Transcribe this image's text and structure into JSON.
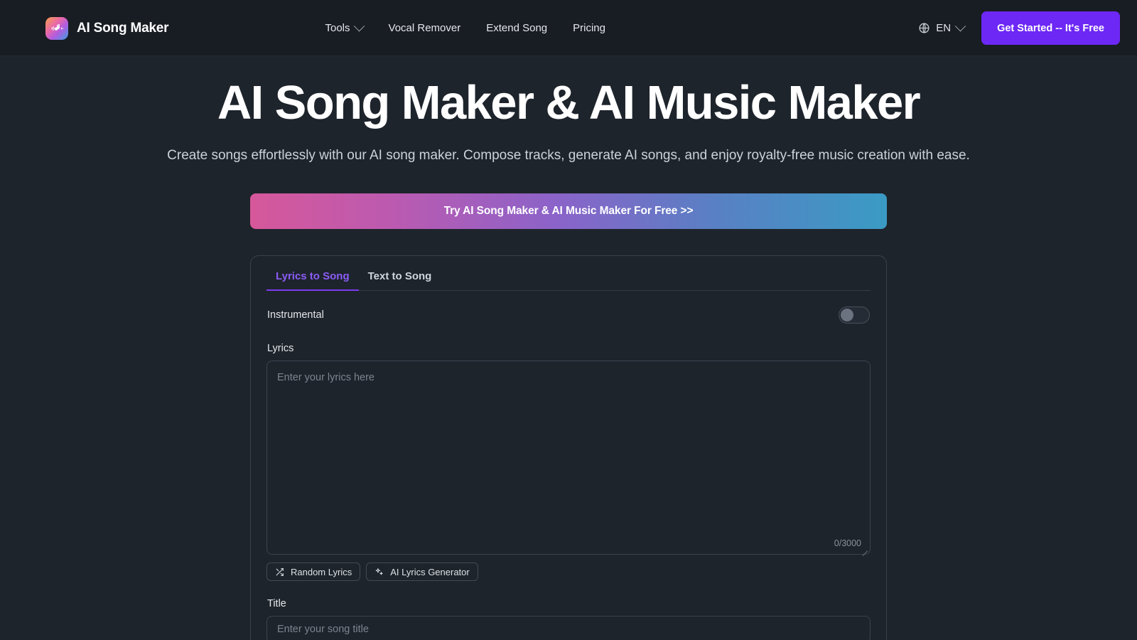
{
  "header": {
    "brand_name": "AI Song Maker",
    "brand_logo_icon": "music-note-logo-icon",
    "nav": [
      {
        "label": "Tools",
        "has_dropdown": true
      },
      {
        "label": "Vocal Remover",
        "has_dropdown": false
      },
      {
        "label": "Extend Song",
        "has_dropdown": false
      },
      {
        "label": "Pricing",
        "has_dropdown": false
      }
    ],
    "language": {
      "icon": "globe-icon",
      "value": "EN"
    },
    "cta_label": "Get Started -- It's Free"
  },
  "hero": {
    "title": "AI Song Maker & AI Music Maker",
    "subtitle": "Create songs effortlessly with our AI song maker. Compose tracks, generate AI songs, and enjoy royalty-free music creation with ease.",
    "try_button_label": "Try AI Song Maker & AI Music Maker For Free >>"
  },
  "generator": {
    "tabs": [
      {
        "label": "Lyrics to Song",
        "active": true
      },
      {
        "label": "Text to Song",
        "active": false
      }
    ],
    "instrumental": {
      "label": "Instrumental",
      "enabled": false
    },
    "lyrics": {
      "label": "Lyrics",
      "placeholder": "Enter your lyrics here",
      "value": "",
      "char_count": "0/3000"
    },
    "lyric_actions": [
      {
        "label": "Random Lyrics",
        "icon": "shuffle-icon"
      },
      {
        "label": "AI Lyrics Generator",
        "icon": "sparkles-icon"
      }
    ],
    "title_field": {
      "label": "Title",
      "placeholder": "Enter your song title",
      "value": ""
    }
  },
  "colors": {
    "page_bg": "#1e242c",
    "header_bg": "#181c23",
    "accent_purple": "#7c3aed",
    "cta_purple": "#6d28f5",
    "tab_active": "#8b5cf6",
    "gradient_start": "#d6589a",
    "gradient_mid": "#8b63c9",
    "gradient_end": "#3a9bc4"
  }
}
